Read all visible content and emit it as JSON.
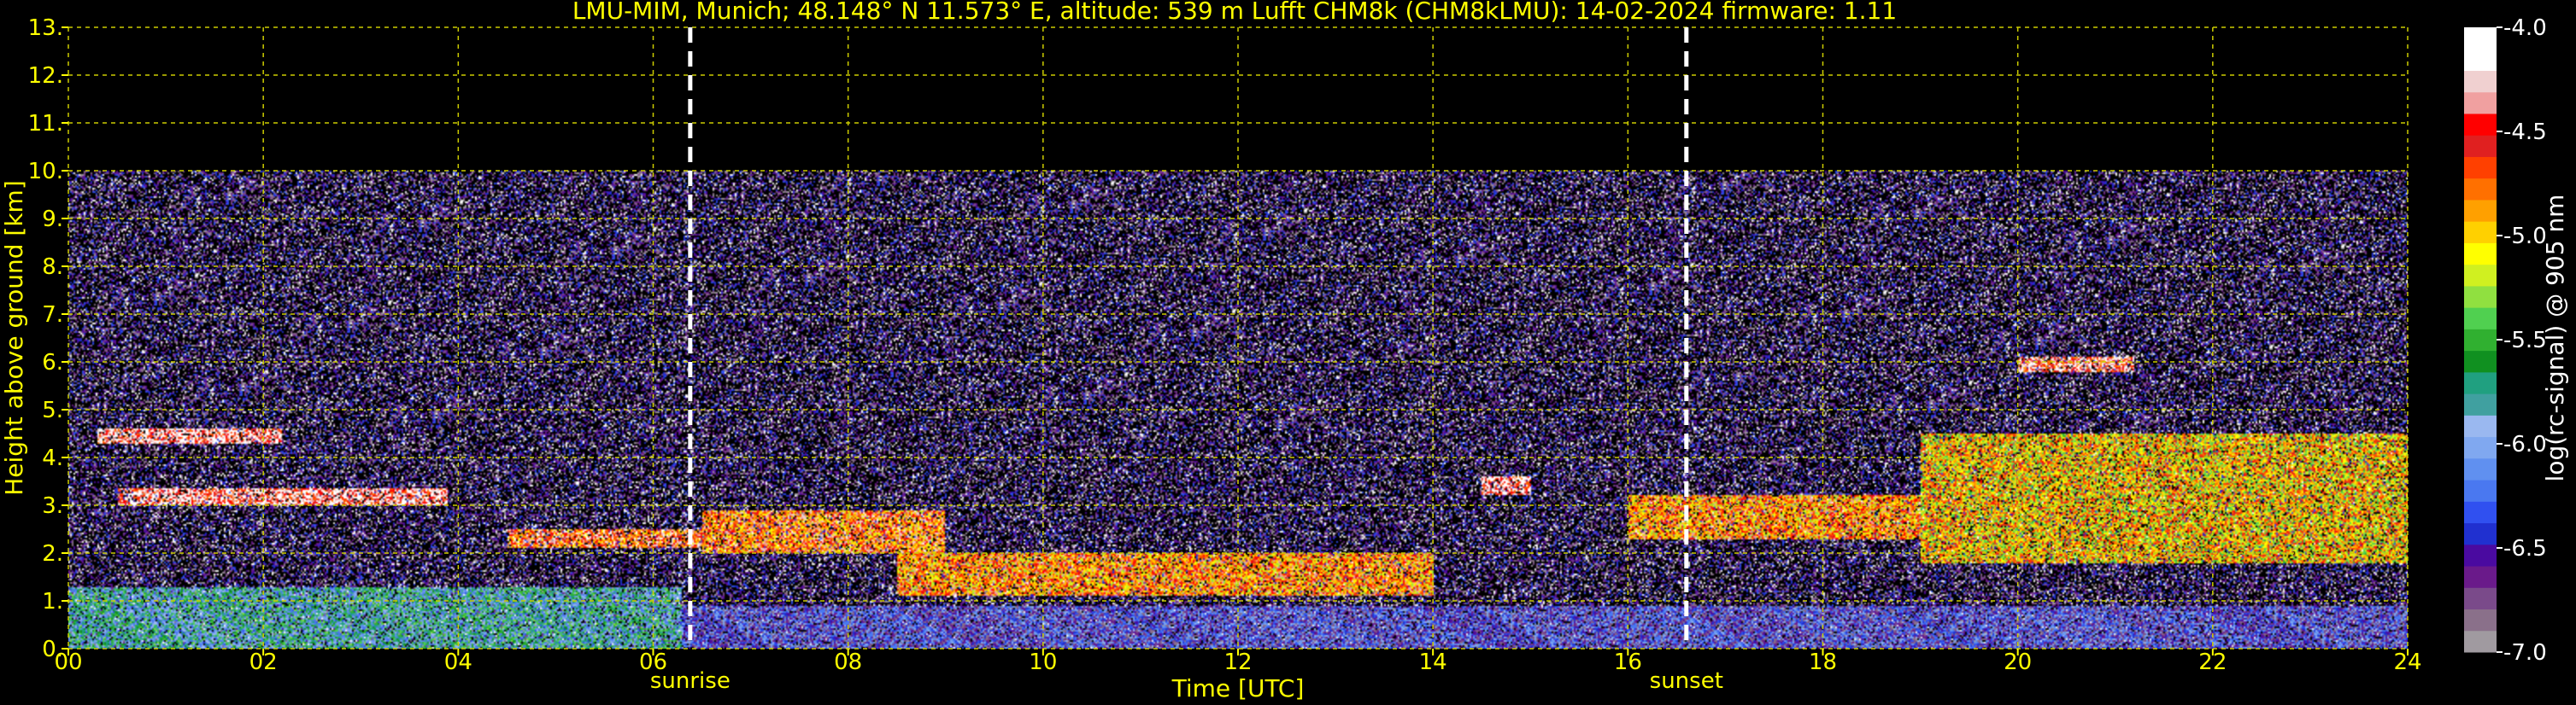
{
  "chart_data": {
    "type": "heatmap",
    "title": "LMU-MIM, Munich; 48.148° N 11.573° E, altitude: 539 m    Lufft CHM8k (CHM8kLMU): 14-02-2024    firmware: 1.11",
    "xlabel": "Time [UTC]",
    "ylabel": "Height above ground [km]",
    "colorbar_label": "log(rc-signal) @ 905 nm",
    "xlim": [
      0,
      24
    ],
    "ylim": [
      0,
      13
    ],
    "x_ticks": [
      "00",
      "02",
      "04",
      "06",
      "08",
      "10",
      "12",
      "14",
      "16",
      "18",
      "20",
      "22",
      "24"
    ],
    "y_ticks": [
      "0.",
      "1.",
      "2.",
      "3.",
      "4.",
      "5.",
      "6.",
      "7.",
      "8.",
      "9.",
      "10.",
      "11.",
      "12.",
      "13."
    ],
    "colorbar_ticks": [
      "-4.0",
      "-4.5",
      "-5.0",
      "-5.5",
      "-6.0",
      "-6.5",
      "-7.0"
    ],
    "colorbar_range": [
      -7.0,
      -4.0
    ],
    "grid": true,
    "data_top_km": 10,
    "markers": [
      {
        "label": "sunrise",
        "x": 6.38
      },
      {
        "label": "sunset",
        "x": 16.6
      }
    ],
    "colors": {
      "background": "#000000",
      "text": "#ffff00",
      "grid": "#cccc00",
      "marker": "#ffffff",
      "colorbar_text": "#ffffff"
    },
    "colormap": [
      "#a09aa0",
      "#8a708a",
      "#7a4a8a",
      "#6a1a8a",
      "#4a0aa0",
      "#2030d0",
      "#3050f0",
      "#4a78f0",
      "#6090f0",
      "#80a8f0",
      "#9ab8f0",
      "#40a0a0",
      "#20a080",
      "#109020",
      "#30b030",
      "#50d050",
      "#90e040",
      "#d0f020",
      "#ffff00",
      "#ffd000",
      "#ffa000",
      "#ff7000",
      "#ff4000",
      "#e02020",
      "#ff0000",
      "#f0a0a0",
      "#f0d0d0",
      "#ffffff",
      "#ffffff"
    ],
    "layers": [
      {
        "name": "boundary layer 00-06",
        "x": [
          0,
          6.3
        ],
        "h": [
          0,
          1.3
        ],
        "intensity": -5.8
      },
      {
        "name": "boundary layer 06-24",
        "x": [
          6.3,
          24
        ],
        "h": [
          0,
          0.9
        ],
        "intensity": -6.4
      },
      {
        "name": "cloud 00-01.3",
        "x": [
          0.3,
          2.2
        ],
        "h": [
          4.3,
          4.6
        ],
        "intensity": -4.3
      },
      {
        "name": "cloud 00-04",
        "x": [
          0.5,
          3.9
        ],
        "h": [
          3.0,
          3.35
        ],
        "intensity": -4.3
      },
      {
        "name": "cloud 04.5-06.5",
        "x": [
          4.5,
          6.5
        ],
        "h": [
          2.1,
          2.5
        ],
        "intensity": -4.6
      },
      {
        "name": "cloud 06.5-09",
        "x": [
          6.5,
          9.0
        ],
        "h": [
          2.0,
          2.9
        ],
        "intensity": -4.7
      },
      {
        "name": "cloud 08.5-14",
        "x": [
          8.5,
          14.0
        ],
        "h": [
          1.1,
          2.0
        ],
        "intensity": -4.8
      },
      {
        "name": "cloud 14.5-15",
        "x": [
          14.5,
          15.0
        ],
        "h": [
          3.2,
          3.6
        ],
        "intensity": -4.3
      },
      {
        "name": "cloud 16-19",
        "x": [
          16.0,
          19.0
        ],
        "h": [
          2.3,
          3.2
        ],
        "intensity": -4.8
      },
      {
        "name": "cloud 19-24 convective",
        "x": [
          19.0,
          24.0
        ],
        "h": [
          1.8,
          4.5
        ],
        "intensity": -5.0
      },
      {
        "name": "cloud 20-21",
        "x": [
          20.0,
          21.2
        ],
        "h": [
          5.8,
          6.1
        ],
        "intensity": -4.4
      }
    ]
  }
}
